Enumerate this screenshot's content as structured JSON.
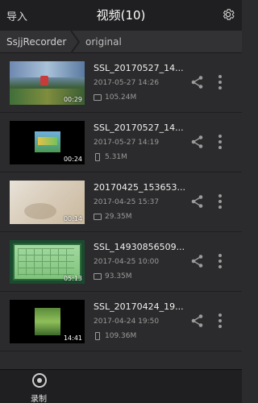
{
  "header": {
    "import_label": "导入",
    "title": "视频(10)",
    "settings_icon": "gear-icon"
  },
  "breadcrumb": {
    "root": "SsjjRecorder",
    "current": "original"
  },
  "videos": [
    {
      "name": "SSL_20170527_14...",
      "date": "2017-05-27 14:26",
      "duration": "00:29",
      "size": "105.24M",
      "size_icon": "screen-icon"
    },
    {
      "name": "SSL_20170527_14...",
      "date": "2017-05-27 14:19",
      "duration": "00:24",
      "size": "5.31M",
      "size_icon": "phone-icon"
    },
    {
      "name": "20170425_153653...",
      "date": "2017-04-25 15:37",
      "duration": "00:14",
      "size": "29.35M",
      "size_icon": "screen-icon"
    },
    {
      "name": "SSL_14930856509...",
      "date": "2017-04-25 10:00",
      "duration": "05:13",
      "size": "93.35M",
      "size_icon": "screen-icon"
    },
    {
      "name": "SSL_20170424_19...",
      "date": "2017-04-24 19:50",
      "duration": "14:41",
      "size": "109.36M",
      "size_icon": "phone-icon"
    }
  ],
  "bottom_bar": {
    "record_label": "录制",
    "record_icon": "record-icon"
  }
}
